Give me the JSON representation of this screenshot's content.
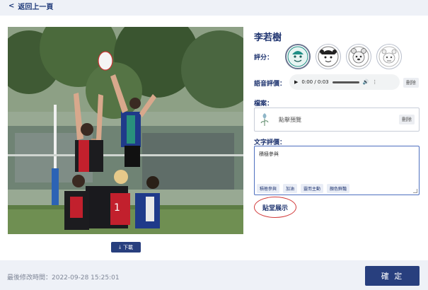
{
  "header": {
    "back_label": "返回上一頁"
  },
  "photo": {
    "download_label": "下載"
  },
  "student": {
    "name": "李若樹"
  },
  "rating": {
    "label": "評分：",
    "options": [
      {
        "name": "excellent",
        "selected": true
      },
      {
        "name": "very-good",
        "selected": false
      },
      {
        "name": "good",
        "selected": false
      },
      {
        "name": "fair",
        "selected": false
      }
    ]
  },
  "voice": {
    "label": "語音評價：",
    "time": "0:00 / 0:03",
    "delete_label": "刪除"
  },
  "file": {
    "label": "檔案：",
    "preview_label": "點擊預覽",
    "delete_label": "刪除"
  },
  "text_review": {
    "label": "文字評價：",
    "value": "積極參與",
    "chips": [
      "積極參與",
      "加油",
      "靈而主動",
      "顏色鮮豔"
    ]
  },
  "showcase_label": "貼堂展示",
  "footer": {
    "last_modified": "最後修改時間：2022-09-28 15:25:01",
    "confirm_label": "確 定"
  },
  "colors": {
    "primary": "#283f7e",
    "accent_red": "#d23b3b",
    "teal_selected": "#1f8f86"
  }
}
